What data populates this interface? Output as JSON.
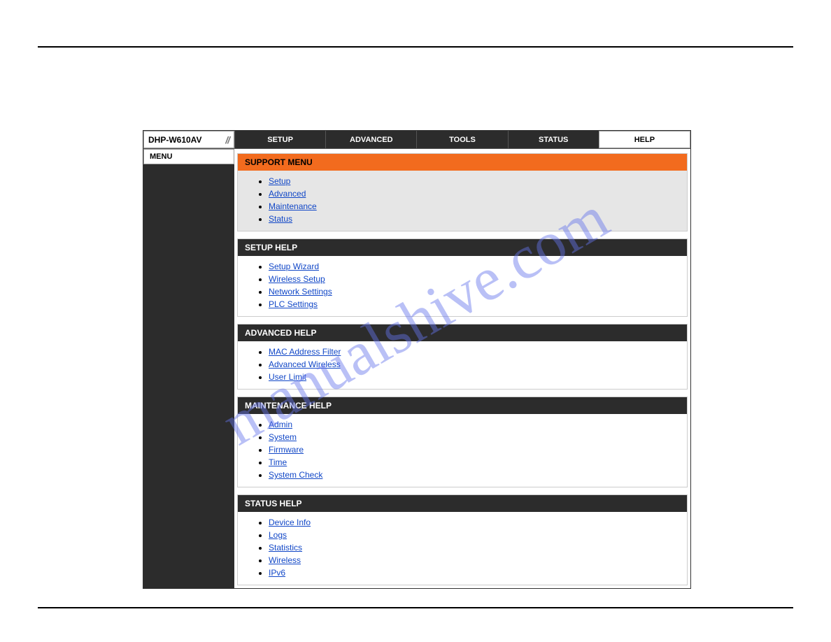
{
  "device": "DHP-W610AV",
  "tabs": [
    "SETUP",
    "ADVANCED",
    "TOOLS",
    "STATUS",
    "HELP"
  ],
  "active_tab": 4,
  "sidebar_label": "MENU",
  "panels": [
    {
      "title": "SUPPORT MENU",
      "orange": true,
      "highlight": true,
      "links": [
        "Setup",
        "Advanced",
        "Maintenance",
        "Status"
      ]
    },
    {
      "title": "SETUP HELP",
      "orange": false,
      "highlight": false,
      "links": [
        "Setup Wizard",
        "Wireless Setup",
        "Network Settings",
        "PLC Settings"
      ]
    },
    {
      "title": "ADVANCED HELP",
      "orange": false,
      "highlight": false,
      "links": [
        "MAC Address Filter",
        "Advanced Wireless",
        "User Limit"
      ]
    },
    {
      "title": "MAINTENANCE HELP",
      "orange": false,
      "highlight": false,
      "links": [
        "Admin",
        "System",
        "Firmware",
        "Time",
        "System Check"
      ]
    },
    {
      "title": "STATUS HELP",
      "orange": false,
      "highlight": false,
      "links": [
        "Device Info",
        "Logs",
        "Statistics",
        "Wireless",
        "IPv6"
      ]
    }
  ],
  "watermark": "manualshive.com"
}
